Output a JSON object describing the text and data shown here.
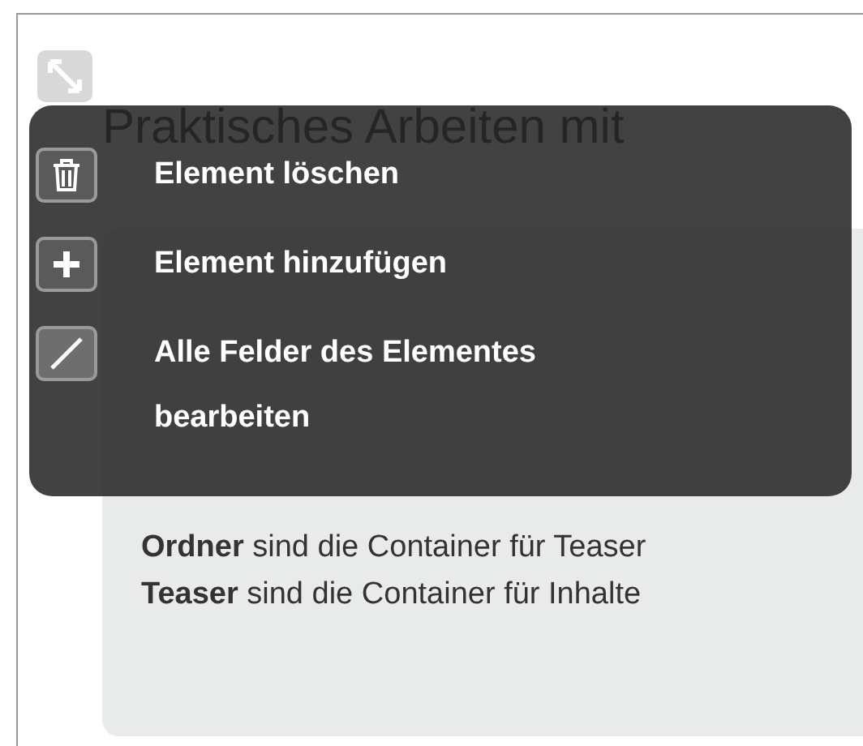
{
  "title": "Praktisches Arbeiten mit",
  "panel": {
    "lines": [
      "**Ordner** sind die Container für Teaser",
      "**Teaser** sind die Container für Inhalte"
    ]
  },
  "context_menu": {
    "items": [
      {
        "kind": "delete",
        "label": "Element löschen"
      },
      {
        "kind": "add",
        "label": "Element hinzufügen"
      },
      {
        "kind": "edit",
        "label": "Alle Felder des Elementes bearbeiten"
      }
    ]
  }
}
